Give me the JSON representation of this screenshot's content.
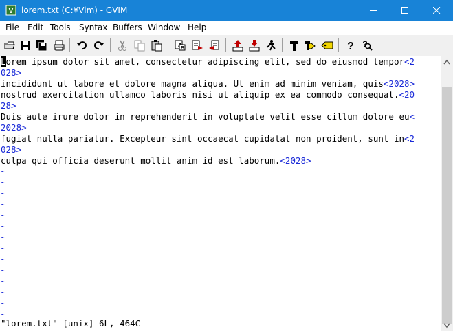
{
  "window": {
    "title": "lorem.txt (C:¥Vim) - GVIM",
    "controls": [
      "minimize",
      "maximize",
      "close"
    ]
  },
  "menu": [
    {
      "label": "File"
    },
    {
      "label": "Edit"
    },
    {
      "label": "Tools"
    },
    {
      "label": "Syntax"
    },
    {
      "label": "Buffers"
    },
    {
      "label": "Window"
    },
    {
      "label": "Help"
    }
  ],
  "toolbar": {
    "buttons": [
      "open-icon",
      "save-icon",
      "save-all-icon",
      "print-icon",
      "undo-icon",
      "redo-icon",
      "cut-icon",
      "copy-icon",
      "paste-icon",
      "replace-icon",
      "find-next-icon",
      "find-prev-icon",
      "load-session-icon",
      "save-session-icon",
      "run-script-icon",
      "make-icon",
      "run-ctags-icon",
      "jump-tag-icon",
      "help-icon",
      "find-help-icon"
    ]
  },
  "editor": {
    "lines": [
      {
        "text": "orem ipsum dolor sit amet, consectetur adipiscing elit, sed do eiusmod tempor",
        "cursor_char": "L",
        "special": "<2"
      },
      {
        "text": "",
        "special": "028>"
      },
      {
        "text": "incididunt ut labore et dolore magna aliqua. Ut enim ad minim veniam, quis",
        "special": "<2028>"
      },
      {
        "text": "nostrud exercitation ullamco laboris nisi ut aliquip ex ea commodo consequat.",
        "special": "<20"
      },
      {
        "text": "",
        "special": "28>"
      },
      {
        "text": "Duis aute irure dolor in reprehenderit in voluptate velit esse cillum dolore eu",
        "special": "<"
      },
      {
        "text": "",
        "special": "2028>"
      },
      {
        "text": "fugiat nulla pariatur. Excepteur sint occaecat cupidatat non proident, sunt in",
        "special": "<2"
      },
      {
        "text": "",
        "special": "028>"
      },
      {
        "text": "culpa qui officia deserunt mollit anim id est laborum.",
        "special": "<2028>"
      }
    ],
    "tilde": "~",
    "status": "\"lorem.txt\" [unix] 6L, 464C"
  },
  "colors": {
    "titlebar": "#1883d7",
    "special_key": "#1a2ad8"
  }
}
